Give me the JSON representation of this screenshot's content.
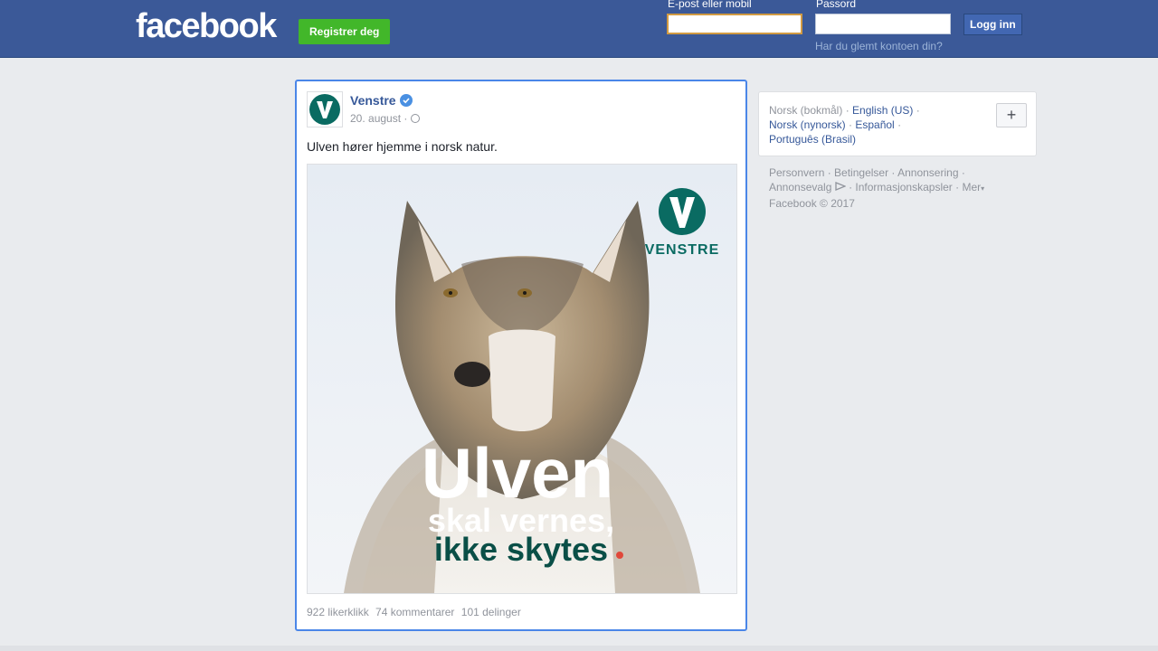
{
  "header": {
    "logo": "facebook",
    "register_label": "Registrer deg",
    "email_label": "E-post eller mobil",
    "email_value": "",
    "password_label": "Passord",
    "password_value": "",
    "login_label": "Logg inn",
    "forgot_label": "Har du glemt kontoen din?"
  },
  "post": {
    "page_name": "Venstre",
    "date": "20. august ·",
    "text": "Ulven hører hjemme i norsk natur.",
    "image": {
      "brand": "VENSTRE",
      "headline": "Ulven",
      "line2": "skal vernes,",
      "line3": "ikke skytes"
    },
    "stats": {
      "likes": "922 likerklikk",
      "comments": "74 kommentarer",
      "shares": "101 delinger"
    }
  },
  "languages": {
    "current": "Norsk (bokmål)",
    "items": [
      "English (US)",
      "Norsk (nynorsk)",
      "Español",
      "Português (Brasil)"
    ],
    "plus_label": "+"
  },
  "footer": {
    "links": [
      "Personvern",
      "Betingelser",
      "Annonsering",
      "Annonsevalg",
      "Informasjonskapsler",
      "Mer"
    ],
    "copyright": "Facebook © 2017"
  },
  "colors": {
    "header_bg": "#3b5998",
    "register_green": "#42b72a",
    "link_blue": "#365899",
    "venstre_teal": "#0a6b62",
    "selection_blue": "#4a86e8"
  }
}
